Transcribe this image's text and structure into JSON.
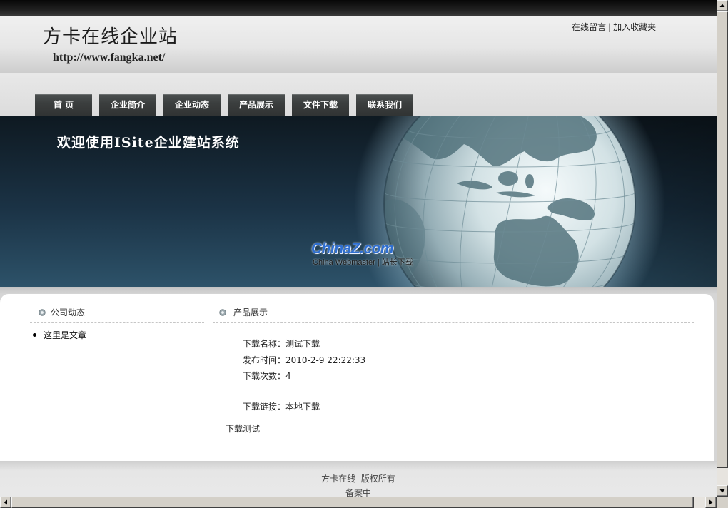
{
  "site": {
    "title": "方卡在线企业站",
    "url": "http://www.fangka.net/"
  },
  "top_links": {
    "items": [
      {
        "label": "在线留言"
      },
      {
        "label": "加入收藏夹"
      }
    ],
    "separator": "|"
  },
  "nav": [
    {
      "label": "首 页"
    },
    {
      "label": "企业简介"
    },
    {
      "label": "企业动态"
    },
    {
      "label": "产品展示"
    },
    {
      "label": "文件下载"
    },
    {
      "label": "联系我们"
    }
  ],
  "banner": {
    "welcome": "欢迎使用ISite企业建站系统",
    "watermark": {
      "brand": "ChinaZ.com",
      "tagline": "China Webmaster | 站长下载"
    }
  },
  "sidebar": {
    "heading": "公司动态",
    "articles": [
      {
        "title": "这里是文章"
      }
    ]
  },
  "main": {
    "heading": "产品展示",
    "fields": [
      {
        "label": "下载名称：",
        "value": "测试下载"
      },
      {
        "label": "发布时间：",
        "value": "2010-2-9 22:22:33"
      },
      {
        "label": "下载次数：",
        "value": "4"
      },
      {
        "label": "下载链接：",
        "value": "本地下载"
      }
    ],
    "description": "下载测试"
  },
  "footer": {
    "copyright": "方卡在线  版权所有",
    "icp": "备案中"
  },
  "icons": {
    "section_heading": "circle-bullet-icon",
    "list_item": "dot-bullet-icon",
    "scrollbar": [
      "arrow-up-icon",
      "arrow-down-icon",
      "arrow-left-icon",
      "arrow-right-icon"
    ]
  },
  "theme": {
    "nav_button": "#3b3e3e",
    "banner_top": "#0e1921",
    "banner_bottom": "#2d5269"
  }
}
